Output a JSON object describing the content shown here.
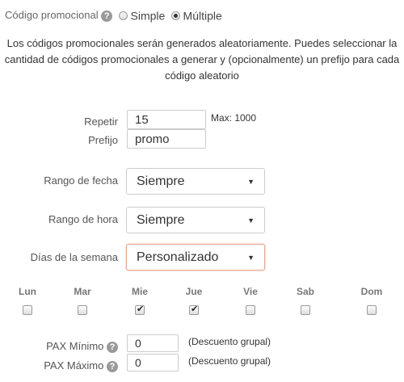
{
  "promo": {
    "label": "Código promocional",
    "help_icon": "question-icon",
    "options": [
      {
        "label": "Simple",
        "selected": false
      },
      {
        "label": "Múltiple",
        "selected": true
      }
    ]
  },
  "description": "Los códigos promocionales serán generados aleatoriamente. Puedes seleccionar la cantidad de códigos promocionales a generar y (opcionalmente) un prefijo para cada código aleatorio",
  "repeat": {
    "label": "Repetir",
    "value": "15",
    "max_note": "Max: 1000"
  },
  "prefix": {
    "label": "Prefijo",
    "value": "promo"
  },
  "date_range": {
    "label": "Rango de fecha",
    "value": "Siempre"
  },
  "time_range": {
    "label": "Rango de hora",
    "value": "Siempre"
  },
  "weekdays": {
    "label": "Días de la semana",
    "value": "Personalizado"
  },
  "days": [
    {
      "name": "Lun",
      "checked": false
    },
    {
      "name": "Mar",
      "checked": false
    },
    {
      "name": "Mie",
      "checked": true
    },
    {
      "name": "Jue",
      "checked": true
    },
    {
      "name": "Vie",
      "checked": false
    },
    {
      "name": "Sab",
      "checked": false
    },
    {
      "name": "Dom",
      "checked": false
    }
  ],
  "pax_min": {
    "label": "PAX Mínimo",
    "value": "0",
    "note": "(Descuento grupal)"
  },
  "pax_max": {
    "label": "PAX Máximo",
    "value": "0",
    "note": "(Descuento grupal)"
  },
  "colors": {
    "focus_border": "#e2a68f",
    "help_icon": "#9a9a9a"
  }
}
